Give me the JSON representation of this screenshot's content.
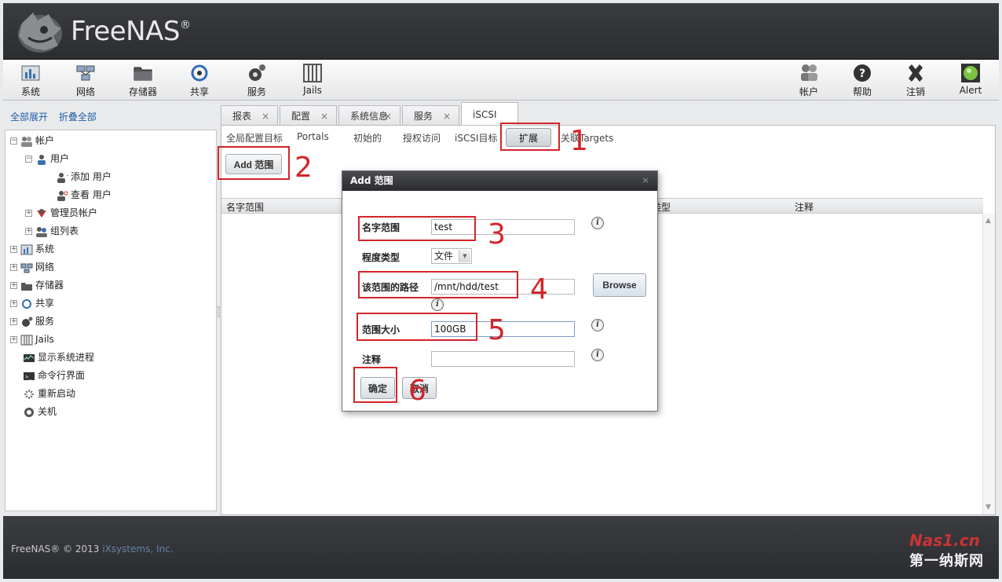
{
  "header": {
    "logo_text": "FreeNAS",
    "logo_mark": "®"
  },
  "toolbar": {
    "left": [
      {
        "label": "系统",
        "icon": "system-icon"
      },
      {
        "label": "网络",
        "icon": "network-icon"
      },
      {
        "label": "存储器",
        "icon": "storage-icon"
      },
      {
        "label": "共享",
        "icon": "sharing-icon"
      },
      {
        "label": "服务",
        "icon": "services-icon"
      },
      {
        "label": "Jails",
        "icon": "jails-icon"
      }
    ],
    "right": [
      {
        "label": "帐户",
        "icon": "account-icon"
      },
      {
        "label": "帮助",
        "icon": "help-icon"
      },
      {
        "label": "注销",
        "icon": "logout-icon"
      },
      {
        "label": "Alert",
        "icon": "alert-icon"
      }
    ]
  },
  "sidebar": {
    "expand_all": "全部展开",
    "collapse_all": "折叠全部",
    "tree": [
      {
        "label": "帐户",
        "icon": "accounts-icon"
      },
      {
        "label": "用户",
        "icon": "user-icon"
      },
      {
        "label": "添加 用户",
        "icon": "add-user-icon"
      },
      {
        "label": "查看 用户",
        "icon": "view-user-icon"
      },
      {
        "label": "管理员帐户",
        "icon": "admin-icon"
      },
      {
        "label": "组列表",
        "icon": "group-icon"
      },
      {
        "label": "系统",
        "icon": "system-icon"
      },
      {
        "label": "网络",
        "icon": "network-icon"
      },
      {
        "label": "存储器",
        "icon": "storage-icon"
      },
      {
        "label": "共享",
        "icon": "sharing-icon"
      },
      {
        "label": "服务",
        "icon": "services-icon"
      },
      {
        "label": "Jails",
        "icon": "jails-icon"
      },
      {
        "label": "显示系统进程",
        "icon": "process-icon"
      },
      {
        "label": "命令行界面",
        "icon": "shell-icon"
      },
      {
        "label": "重新启动",
        "icon": "reboot-icon"
      },
      {
        "label": "关机",
        "icon": "shutdown-icon"
      }
    ]
  },
  "tabs": [
    {
      "label": "报表",
      "close": "×"
    },
    {
      "label": "配置",
      "close": "×"
    },
    {
      "label": "系统信息",
      "close": "×"
    },
    {
      "label": "服务",
      "close": "×"
    },
    {
      "label": "iSCSI",
      "close": ""
    }
  ],
  "subtabs": [
    "全局配置目标",
    "Portals",
    "初始的",
    "授权访问",
    "iSCSI目标",
    "扩展",
    "关联Targets"
  ],
  "main": {
    "add_button": "Add 范围",
    "grid_columns": [
      "名字范围",
      "类型",
      "注释"
    ]
  },
  "dialog": {
    "title": "Add 范围",
    "close": "×",
    "fields": {
      "name_label": "名字范围",
      "name_value": "test",
      "type_label": "程度类型",
      "type_value": "文件",
      "path_label": "该范围的路径",
      "path_value": "/mnt/hdd/test",
      "size_label": "范围大小",
      "size_value": "100GB",
      "comment_label": "注释",
      "comment_value": ""
    },
    "browse_button": "Browse",
    "ok_button": "确定",
    "cancel_button": "取消",
    "help_glyph": "i"
  },
  "annotations": [
    "1",
    "2",
    "3",
    "4",
    "5",
    "6"
  ],
  "footer": {
    "copyright": "FreeNAS® © 2013 ",
    "company": "iXsystems, Inc."
  },
  "watermark": {
    "line1": "Nas1.cn",
    "line2": "第一纳斯网"
  },
  "colors": {
    "annotation_red": "#d3242a",
    "header_bg": "#2b2d31",
    "link_blue": "#1f5fa8"
  }
}
